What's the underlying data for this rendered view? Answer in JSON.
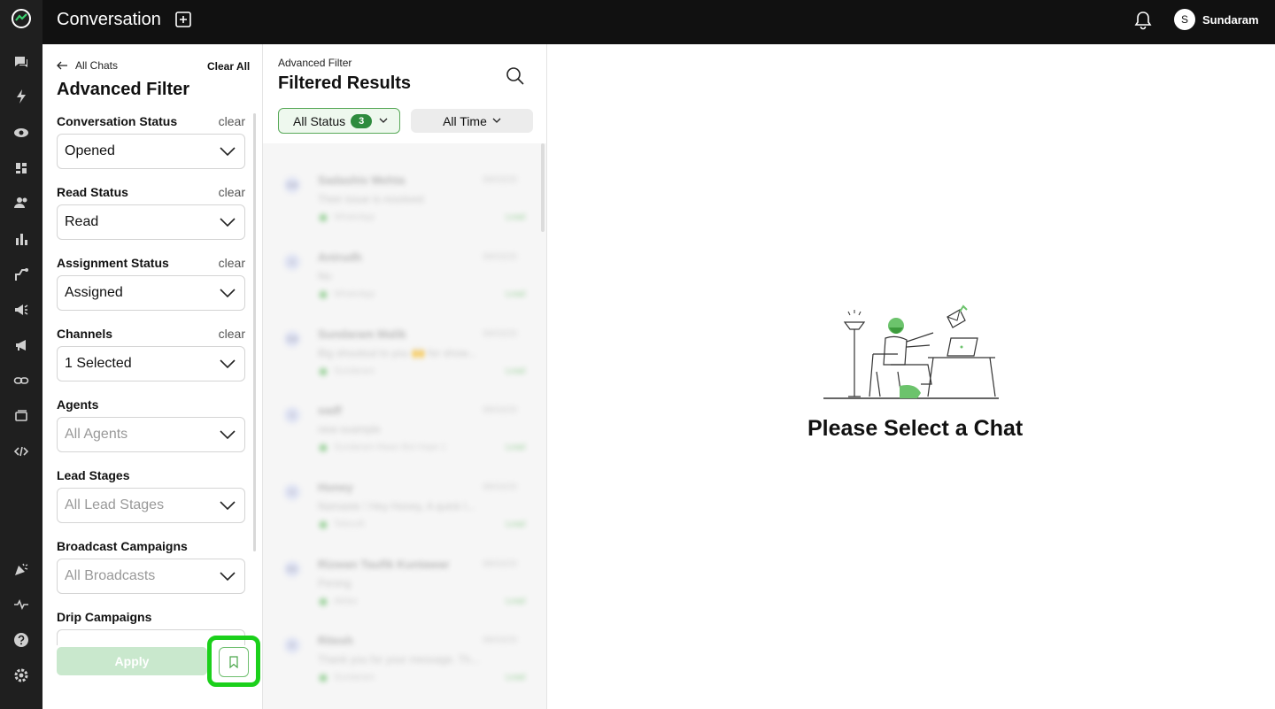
{
  "app": {
    "title": "Conversation",
    "user_initial": "S",
    "user_name": "Sundaram",
    "accent": "#2e8b3e"
  },
  "rail": {
    "items": [
      "chats-icon",
      "lightning-icon",
      "eye-icon",
      "dashboard-icon",
      "contacts-icon",
      "analytics-icon",
      "flows-icon",
      "broadcast-icon",
      "campaign-icon",
      "link-icon",
      "templates-icon",
      "code-icon",
      "party-icon",
      "activity-icon",
      "help-icon",
      "settings-icon"
    ]
  },
  "filter": {
    "back_label": "All Chats",
    "clear_all": "Clear All",
    "title": "Advanced Filter",
    "clear_label": "clear",
    "sections": [
      {
        "label": "Conversation Status",
        "value": "Opened",
        "clear": true
      },
      {
        "label": "Read Status",
        "value": "Read",
        "clear": true
      },
      {
        "label": "Assignment Status",
        "value": "Assigned",
        "clear": true
      },
      {
        "label": "Channels",
        "value": "1 Selected",
        "clear": true
      },
      {
        "label": "Agents",
        "placeholder": "All Agents"
      },
      {
        "label": "Lead Stages",
        "placeholder": "All Lead Stages"
      },
      {
        "label": "Broadcast Campaigns",
        "placeholder": "All Broadcasts"
      },
      {
        "label": "Drip Campaigns"
      }
    ],
    "apply": "Apply"
  },
  "results": {
    "subtitle": "Advanced Filter",
    "title": "Filtered Results",
    "status_pill": "All Status",
    "status_count": "3",
    "time_pill": "All Time",
    "items": [
      {
        "initials": "SM",
        "name": "Sadashiv Mehta",
        "date": "09/03/25",
        "message": "Their issue is resolved",
        "channel": "WhatsApp",
        "tag": "Lead"
      },
      {
        "initials": "A",
        "name": "Anirudh",
        "date": "09/03/25",
        "message": "No",
        "channel": "WhatsApp",
        "tag": "Lead"
      },
      {
        "initials": "SM",
        "name": "Sundaram Malik",
        "date": "09/03/25",
        "message": "Big shoutout to you 🙌 for show...",
        "channel": "Sundaram",
        "tag": "Lead"
      },
      {
        "initials": "S",
        "name": "sadf",
        "date": "08/03/25",
        "message": "new example",
        "channel": "Sundaram Maan Bot Hope 1",
        "tag": "Lead"
      },
      {
        "initials": "H",
        "name": "Honey",
        "date": "08/03/25",
        "message": "Namaste ! Hey Honey, A quick I...",
        "channel": "Telesoft",
        "tag": "Lead"
      },
      {
        "initials": "RK",
        "name": "Rizwan Taufik Kuntawar",
        "date": "08/03/25",
        "message": "Pening",
        "channel": "Akilax",
        "tag": "Lead"
      },
      {
        "initials": "R",
        "name": "Ritesh",
        "date": "08/03/25",
        "message": "Thank you for your message. Th...",
        "channel": "Sundaram",
        "tag": "Lead"
      }
    ]
  },
  "empty_state": {
    "message": "Please Select a Chat"
  }
}
